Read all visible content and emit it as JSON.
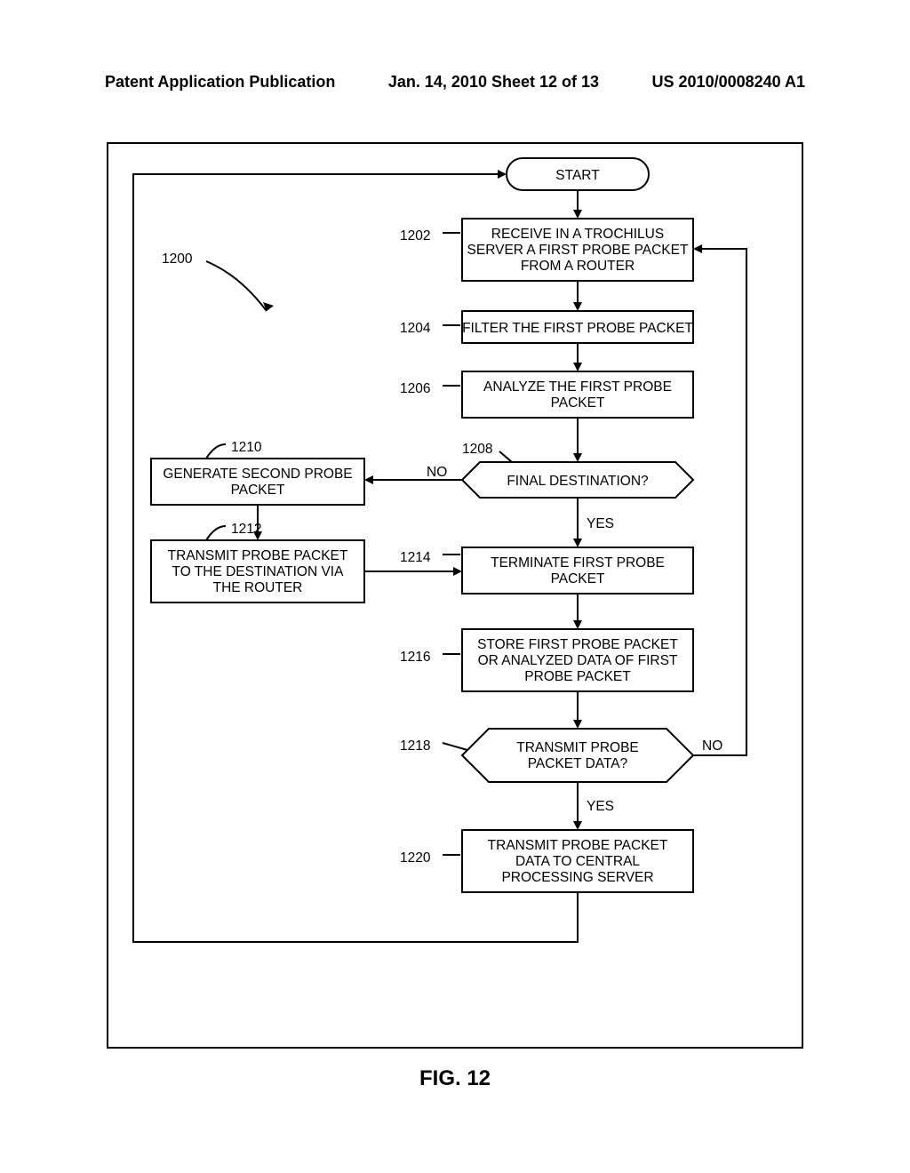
{
  "header": {
    "left": "Patent Application Publication",
    "center": "Jan. 14, 2010  Sheet 12 of 13",
    "right": "US 2010/0008240 A1"
  },
  "figure_caption": "FIG. 12",
  "refs": {
    "r1200": "1200",
    "r1202": "1202",
    "r1204": "1204",
    "r1206": "1206",
    "r1208": "1208",
    "r1210": "1210",
    "r1212": "1212",
    "r1214": "1214",
    "r1216": "1216",
    "r1218": "1218",
    "r1220": "1220"
  },
  "labels": {
    "start": "START",
    "b1202_l1": "RECEIVE IN A TROCHILUS",
    "b1202_l2": "SERVER A FIRST PROBE PACKET",
    "b1202_l3": "FROM A ROUTER",
    "b1204": "FILTER THE FIRST PROBE PACKET",
    "b1206_l1": "ANALYZE THE FIRST PROBE",
    "b1206_l2": "PACKET",
    "d1208": "FINAL DESTINATION?",
    "b1210_l1": "GENERATE SECOND PROBE",
    "b1210_l2": "PACKET",
    "b1212_l1": "TRANSMIT PROBE PACKET",
    "b1212_l2": "TO THE DESTINATION VIA",
    "b1212_l3": "THE ROUTER",
    "b1214_l1": "TERMINATE FIRST PROBE",
    "b1214_l2": "PACKET",
    "b1216_l1": "STORE FIRST PROBE PACKET",
    "b1216_l2": "OR ANALYZED DATA OF FIRST",
    "b1216_l3": "PROBE PACKET",
    "d1218_l1": "TRANSMIT PROBE",
    "d1218_l2": "PACKET DATA?",
    "b1220_l1": "TRANSMIT PROBE PACKET",
    "b1220_l2": "DATA TO CENTRAL",
    "b1220_l3": "PROCESSING SERVER",
    "yes": "YES",
    "no": "NO"
  }
}
